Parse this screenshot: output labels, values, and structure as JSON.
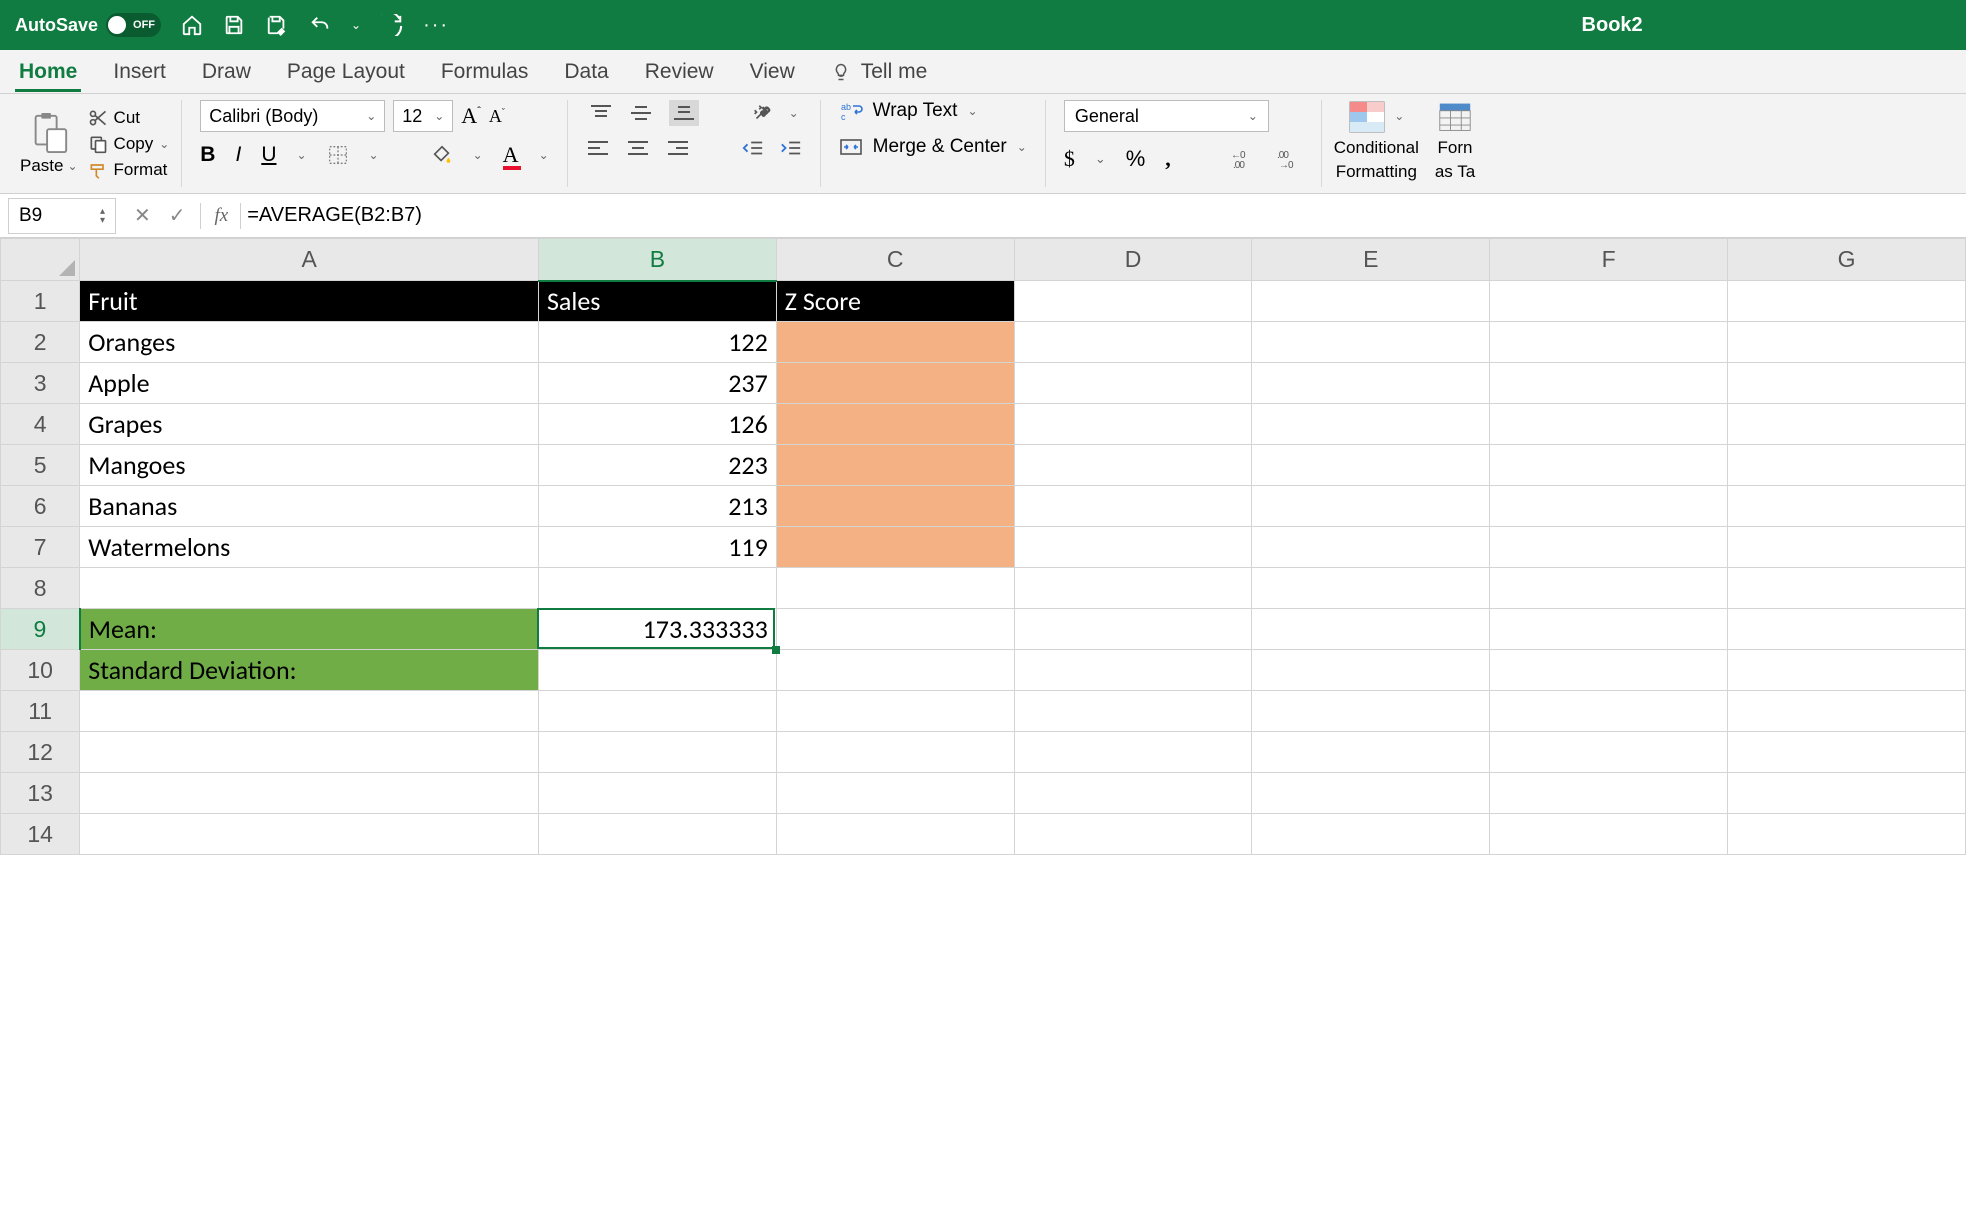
{
  "titlebar": {
    "autosave_label": "AutoSave",
    "autosave_state": "OFF",
    "book_title": "Book2"
  },
  "tabs": {
    "home": "Home",
    "insert": "Insert",
    "draw": "Draw",
    "page_layout": "Page Layout",
    "formulas": "Formulas",
    "data": "Data",
    "review": "Review",
    "view": "View",
    "tell_me": "Tell me"
  },
  "ribbon": {
    "paste": "Paste",
    "cut": "Cut",
    "copy": "Copy",
    "format": "Format",
    "font_name": "Calibri (Body)",
    "font_size": "12",
    "wrap_text": "Wrap Text",
    "merge_center": "Merge & Center",
    "number_format": "General",
    "cond_format1": "Conditional",
    "cond_format2": "Formatting",
    "fmt_table1": "Forn",
    "fmt_table2": "as Ta"
  },
  "formula_bar": {
    "name_box": "B9",
    "fx": "fx",
    "formula": "=AVERAGE(B2:B7)"
  },
  "columns": [
    "A",
    "B",
    "C",
    "D",
    "E",
    "F",
    "G"
  ],
  "row_numbers": [
    "1",
    "2",
    "3",
    "4",
    "5",
    "6",
    "7",
    "8",
    "9",
    "10",
    "11",
    "12",
    "13",
    "14"
  ],
  "sheet": {
    "headers": {
      "A": "Fruit",
      "B": "Sales",
      "C": "Z Score"
    },
    "rows": [
      {
        "fruit": "Oranges",
        "sales": "122"
      },
      {
        "fruit": "Apple",
        "sales": "237"
      },
      {
        "fruit": "Grapes",
        "sales": "126"
      },
      {
        "fruit": "Mangoes",
        "sales": "223"
      },
      {
        "fruit": "Bananas",
        "sales": "213"
      },
      {
        "fruit": "Watermelons",
        "sales": "119"
      }
    ],
    "mean_label": "Mean:",
    "mean_value": "173.333333",
    "stdev_label": "Standard Deviation:"
  },
  "colors": {
    "brand": "#107c41",
    "header_black": "#000000",
    "orange_fill": "#f4b183",
    "green_fill": "#70ad47"
  }
}
